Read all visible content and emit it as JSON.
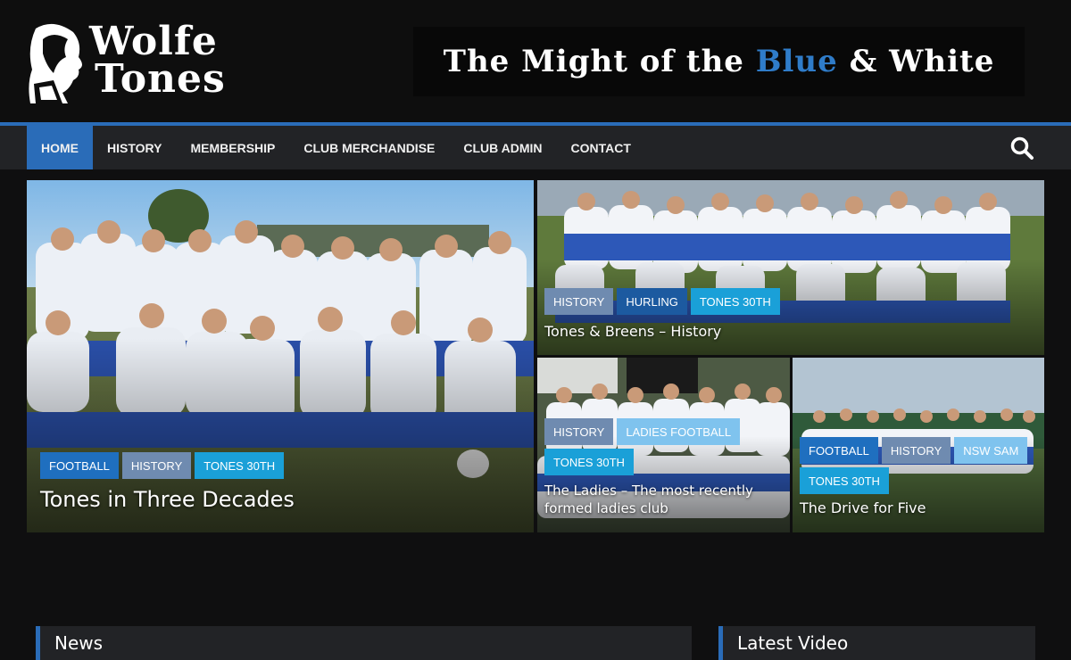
{
  "header": {
    "logo_line1": "Wolfe",
    "logo_line2": "Tones",
    "tagline_part1": "The Might of the ",
    "tagline_blue": "Blue",
    "tagline_part2": " & White"
  },
  "nav": {
    "items": [
      {
        "label": "HOME",
        "active": true
      },
      {
        "label": "HISTORY"
      },
      {
        "label": "MEMBERSHIP"
      },
      {
        "label": "CLUB MERCHANDISE"
      },
      {
        "label": "CLUB ADMIN"
      },
      {
        "label": "CONTACT"
      }
    ]
  },
  "featured": [
    {
      "title": "Tones in Three Decades",
      "tags": [
        "FOOTBALL",
        "HISTORY",
        "TONES 30TH"
      ]
    },
    {
      "title": "Tones & Breens – History",
      "tags": [
        "HISTORY",
        "HURLING",
        "TONES 30TH"
      ]
    },
    {
      "title_line1": "The Ladies – The most recently",
      "title_line2": "formed ladies club",
      "tags": [
        "HISTORY",
        "LADIES FOOTBALL",
        "TONES 30TH"
      ]
    },
    {
      "title": "The Drive for Five",
      "tags": [
        "FOOTBALL",
        "HISTORY",
        "NSW SAM",
        "TONES 30TH"
      ]
    }
  ],
  "widgets": {
    "news": "News",
    "latest_video": "Latest Video"
  },
  "colors": {
    "accent": "#2a6cb8",
    "nav_bg": "#222326",
    "page_bg": "#0f0f10"
  }
}
